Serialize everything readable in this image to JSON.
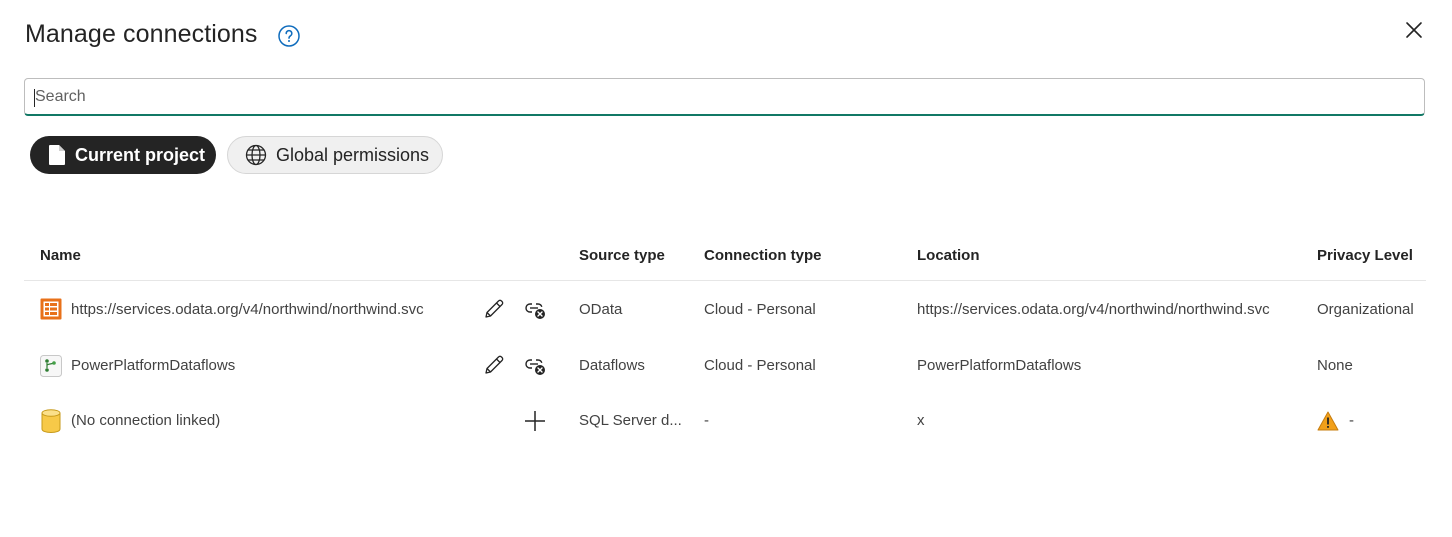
{
  "dialog": {
    "title": "Manage connections"
  },
  "search": {
    "placeholder": "Search",
    "value": ""
  },
  "scope_pills": {
    "current_project": "Current project",
    "global_permissions": "Global permissions"
  },
  "table": {
    "headers": {
      "name": "Name",
      "source_type": "Source type",
      "connection_type": "Connection type",
      "location": "Location",
      "privacy_level": "Privacy Level"
    },
    "rows": [
      {
        "icon": "odata-source-icon",
        "name": "https://services.odata.org/v4/northwind/northwind.svc",
        "actions": [
          "edit-pencil-icon",
          "unlink-connection-icon"
        ],
        "source_type": "OData",
        "connection_type": "Cloud - Personal",
        "location": "https://services.odata.org/v4/northwind/northwind.svc",
        "privacy_level": "Organizational"
      },
      {
        "icon": "dataflows-source-icon",
        "name": "PowerPlatformDataflows",
        "actions": [
          "edit-pencil-icon",
          "unlink-connection-icon"
        ],
        "source_type": "Dataflows",
        "connection_type": "Cloud - Personal",
        "location": "PowerPlatformDataflows",
        "privacy_level": "None"
      },
      {
        "icon": "database-icon",
        "name": "(No connection linked)",
        "actions": [
          "add-icon"
        ],
        "source_type": "SQL Server d...",
        "connection_type": "-",
        "location": "x",
        "privacy_level": "-",
        "privacy_warning": true
      }
    ]
  },
  "colors": {
    "accent_underline": "#117865",
    "help_blue": "#0f6cbd",
    "odata_orange": "#e8711a",
    "warning_orange": "#f2a01a",
    "database_yellow": "#f7c948"
  }
}
